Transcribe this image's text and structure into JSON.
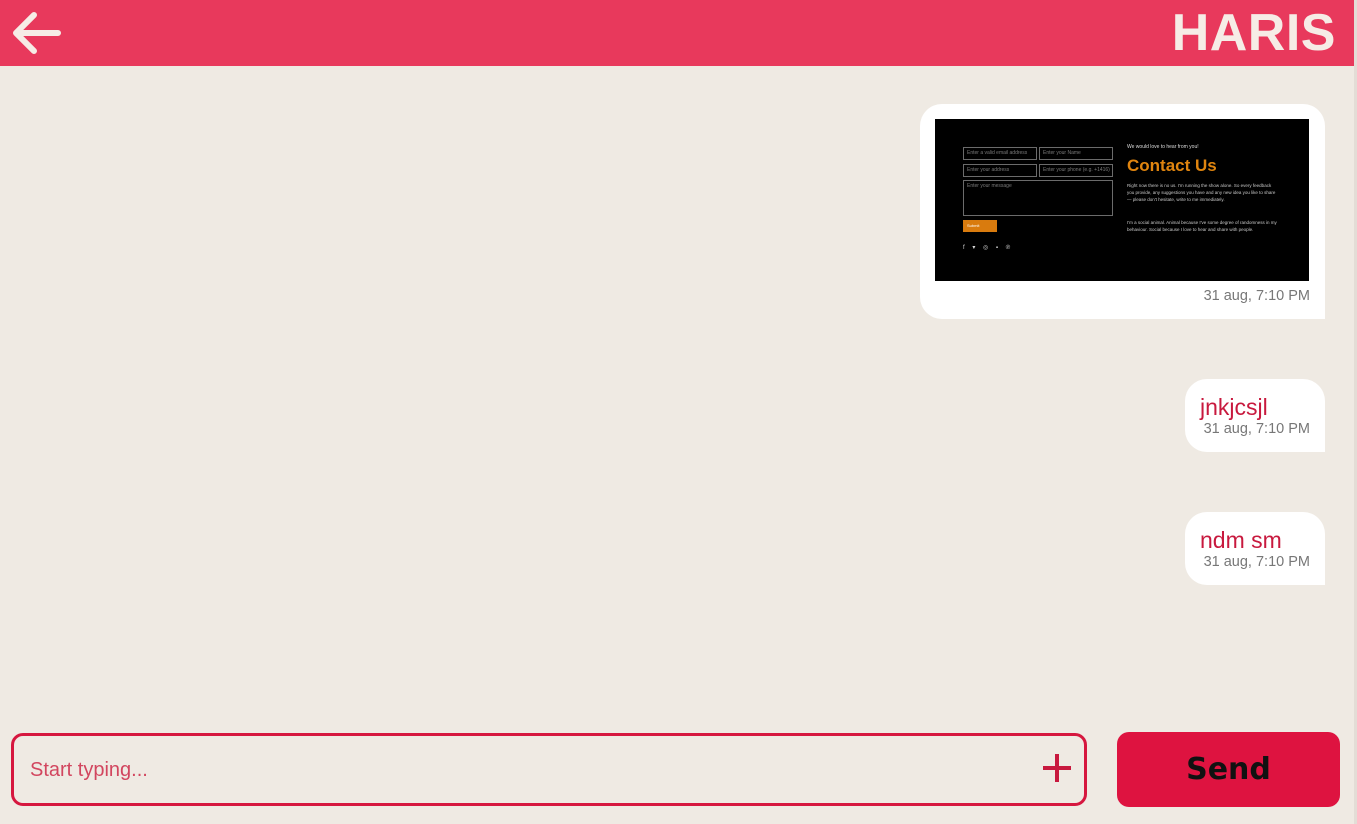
{
  "header": {
    "back_icon": "arrow-left-icon",
    "title": "HARIS"
  },
  "messages": [
    {
      "type": "image",
      "time": "31 aug, 7:10 PM",
      "image": {
        "description_label": "contact-us-screenshot",
        "fields": [
          "Enter a valid email address",
          "Enter your Name",
          "Enter your address",
          "Enter your phone (e.g. +1416)",
          "Enter your message"
        ],
        "submit": "Submit",
        "socials": "f ▾ ◎ ▪ ℗",
        "kicker": "We would love to hear from you!",
        "title": "Contact Us",
        "para1": "Right now there is no us. I'm running the show alone. So every feedback you provide, any suggestions you have and any new idea you like to share — please don't hesitate, write to me immediately.",
        "para2": "I'm a social animal. Animal because I've some degree of randomness in my behaviour. Social because I love to hear and share with people."
      }
    },
    {
      "type": "text",
      "text": "jnkjcsjl",
      "time": "31 aug, 7:10 PM"
    },
    {
      "type": "text",
      "text": "ndm sm",
      "time": "31 aug, 7:10 PM"
    }
  ],
  "composer": {
    "placeholder": "Start typing...",
    "value": "",
    "attach_icon": "plus-icon",
    "send_label": "Send"
  },
  "colors": {
    "accent": "#e8395c",
    "send": "#de1340",
    "background": "#efeae3",
    "message_text": "#c8193e"
  }
}
